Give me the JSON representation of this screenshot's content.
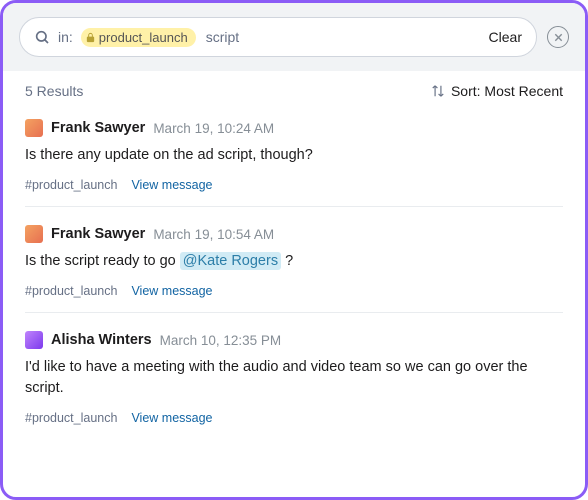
{
  "search": {
    "prefix": "in:",
    "channel_token": "product_launch",
    "query": "script",
    "clear_label": "Clear"
  },
  "results_count_label": "5 Results",
  "sort_label": "Sort: Most Recent",
  "results": [
    {
      "author": "Frank Sawyer",
      "time": "March 19, 10:24 AM",
      "message_pre": "Is there any update on the ad script, though?",
      "mention": "",
      "message_post": "",
      "channel": "#product_launch",
      "view_label": "View message",
      "avatar_class": "av1"
    },
    {
      "author": "Frank Sawyer",
      "time": "March 19, 10:54 AM",
      "message_pre": "Is the script ready to go ",
      "mention": "@Kate Rogers",
      "message_post": " ?",
      "channel": "#product_launch",
      "view_label": "View message",
      "avatar_class": "av1"
    },
    {
      "author": "Alisha Winters",
      "time": "March 10, 12:35 PM",
      "message_pre": "I'd like to have a meeting with the audio and video team so we can go over the script.",
      "mention": "",
      "message_post": "",
      "channel": "#product_launch",
      "view_label": "View message",
      "avatar_class": "av2"
    }
  ]
}
